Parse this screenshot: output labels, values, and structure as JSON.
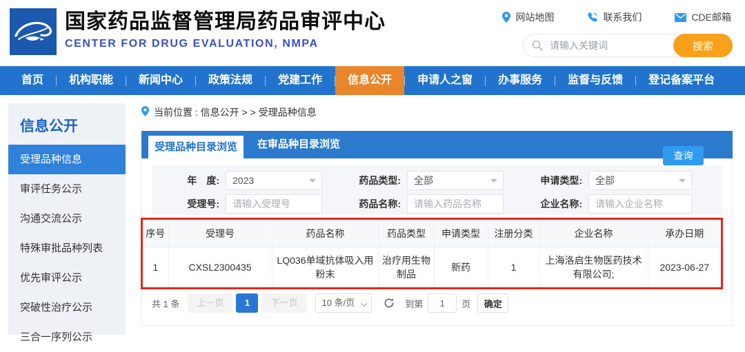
{
  "header": {
    "title": "国家药品监督管理局药品审评中心",
    "subtitle": "CENTER FOR DRUG EVALUATION, NMPA",
    "links": [
      {
        "label": "网站地图"
      },
      {
        "label": "联系我们"
      },
      {
        "label": "CDE邮箱"
      }
    ],
    "search": {
      "placeholder": "请输入关键词",
      "button_label": "搜索"
    }
  },
  "nav": {
    "items": [
      {
        "label": "首页"
      },
      {
        "label": "机构职能"
      },
      {
        "label": "新闻中心"
      },
      {
        "label": "政策法规"
      },
      {
        "label": "党建工作"
      },
      {
        "label": "信息公开",
        "active": true
      },
      {
        "label": "申请人之窗"
      },
      {
        "label": "办事服务"
      },
      {
        "label": "监督与反馈"
      },
      {
        "label": "登记备案平台"
      }
    ]
  },
  "sidebar": {
    "title": "信息公开",
    "items": [
      {
        "label": "受理品种信息",
        "active": true
      },
      {
        "label": "审评任务公示"
      },
      {
        "label": "沟通交流公示"
      },
      {
        "label": "特殊审批品种列表"
      },
      {
        "label": "优先审评公示"
      },
      {
        "label": "突破性治疗公示"
      },
      {
        "label": "三合一序列公示"
      }
    ]
  },
  "main": {
    "breadcrumb": "当前位置 : 信息公开 > > 受理品种信息",
    "tabs": [
      {
        "label": "受理品种目录浏览",
        "active": true
      },
      {
        "label": "在审品种目录浏览"
      }
    ],
    "filters": {
      "year_label": "年　度:",
      "year_value": "2023",
      "drug_type_label": "药品类型:",
      "drug_type_value": "全部",
      "apply_type_label": "申请类型:",
      "apply_type_value": "全部",
      "acceptance_label": "受理号:",
      "acceptance_placeholder": "请输入受理号",
      "drug_name_label": "药品名称:",
      "drug_name_placeholder": "请输入药品名称",
      "company_label": "企业名称:",
      "company_placeholder": "请输入企业名称",
      "query_button": "查询"
    },
    "table": {
      "headers": [
        "序号",
        "受理号",
        "药品名称",
        "药品类型",
        "申请类型",
        "注册分类",
        "企业名称",
        "承办日期"
      ],
      "rows": [
        [
          "1",
          "CXSL2300435",
          "LQ036单域抗体吸入用粉末",
          "治疗用生物制品",
          "新药",
          "1",
          "上海洛启生物医药技术有限公司;",
          "2023-06-27"
        ]
      ]
    },
    "pagination": {
      "total": "共 1 条",
      "prev": "上一页",
      "current_page": "1",
      "next": "下一页",
      "page_size": "10 条/页",
      "goto_label": "到第",
      "goto_value": "1",
      "goto_unit": "页",
      "confirm": "确定"
    }
  },
  "colors": {
    "nav_blue": "#2173cd",
    "active_orange": "#e9862c",
    "search_orange": "#f9a11b",
    "query_blue": "#2e9bf0",
    "highlight_red": "#e5261d",
    "active_page_blue": "#2a76d2",
    "sidebar_active_blue": "#3081da"
  }
}
